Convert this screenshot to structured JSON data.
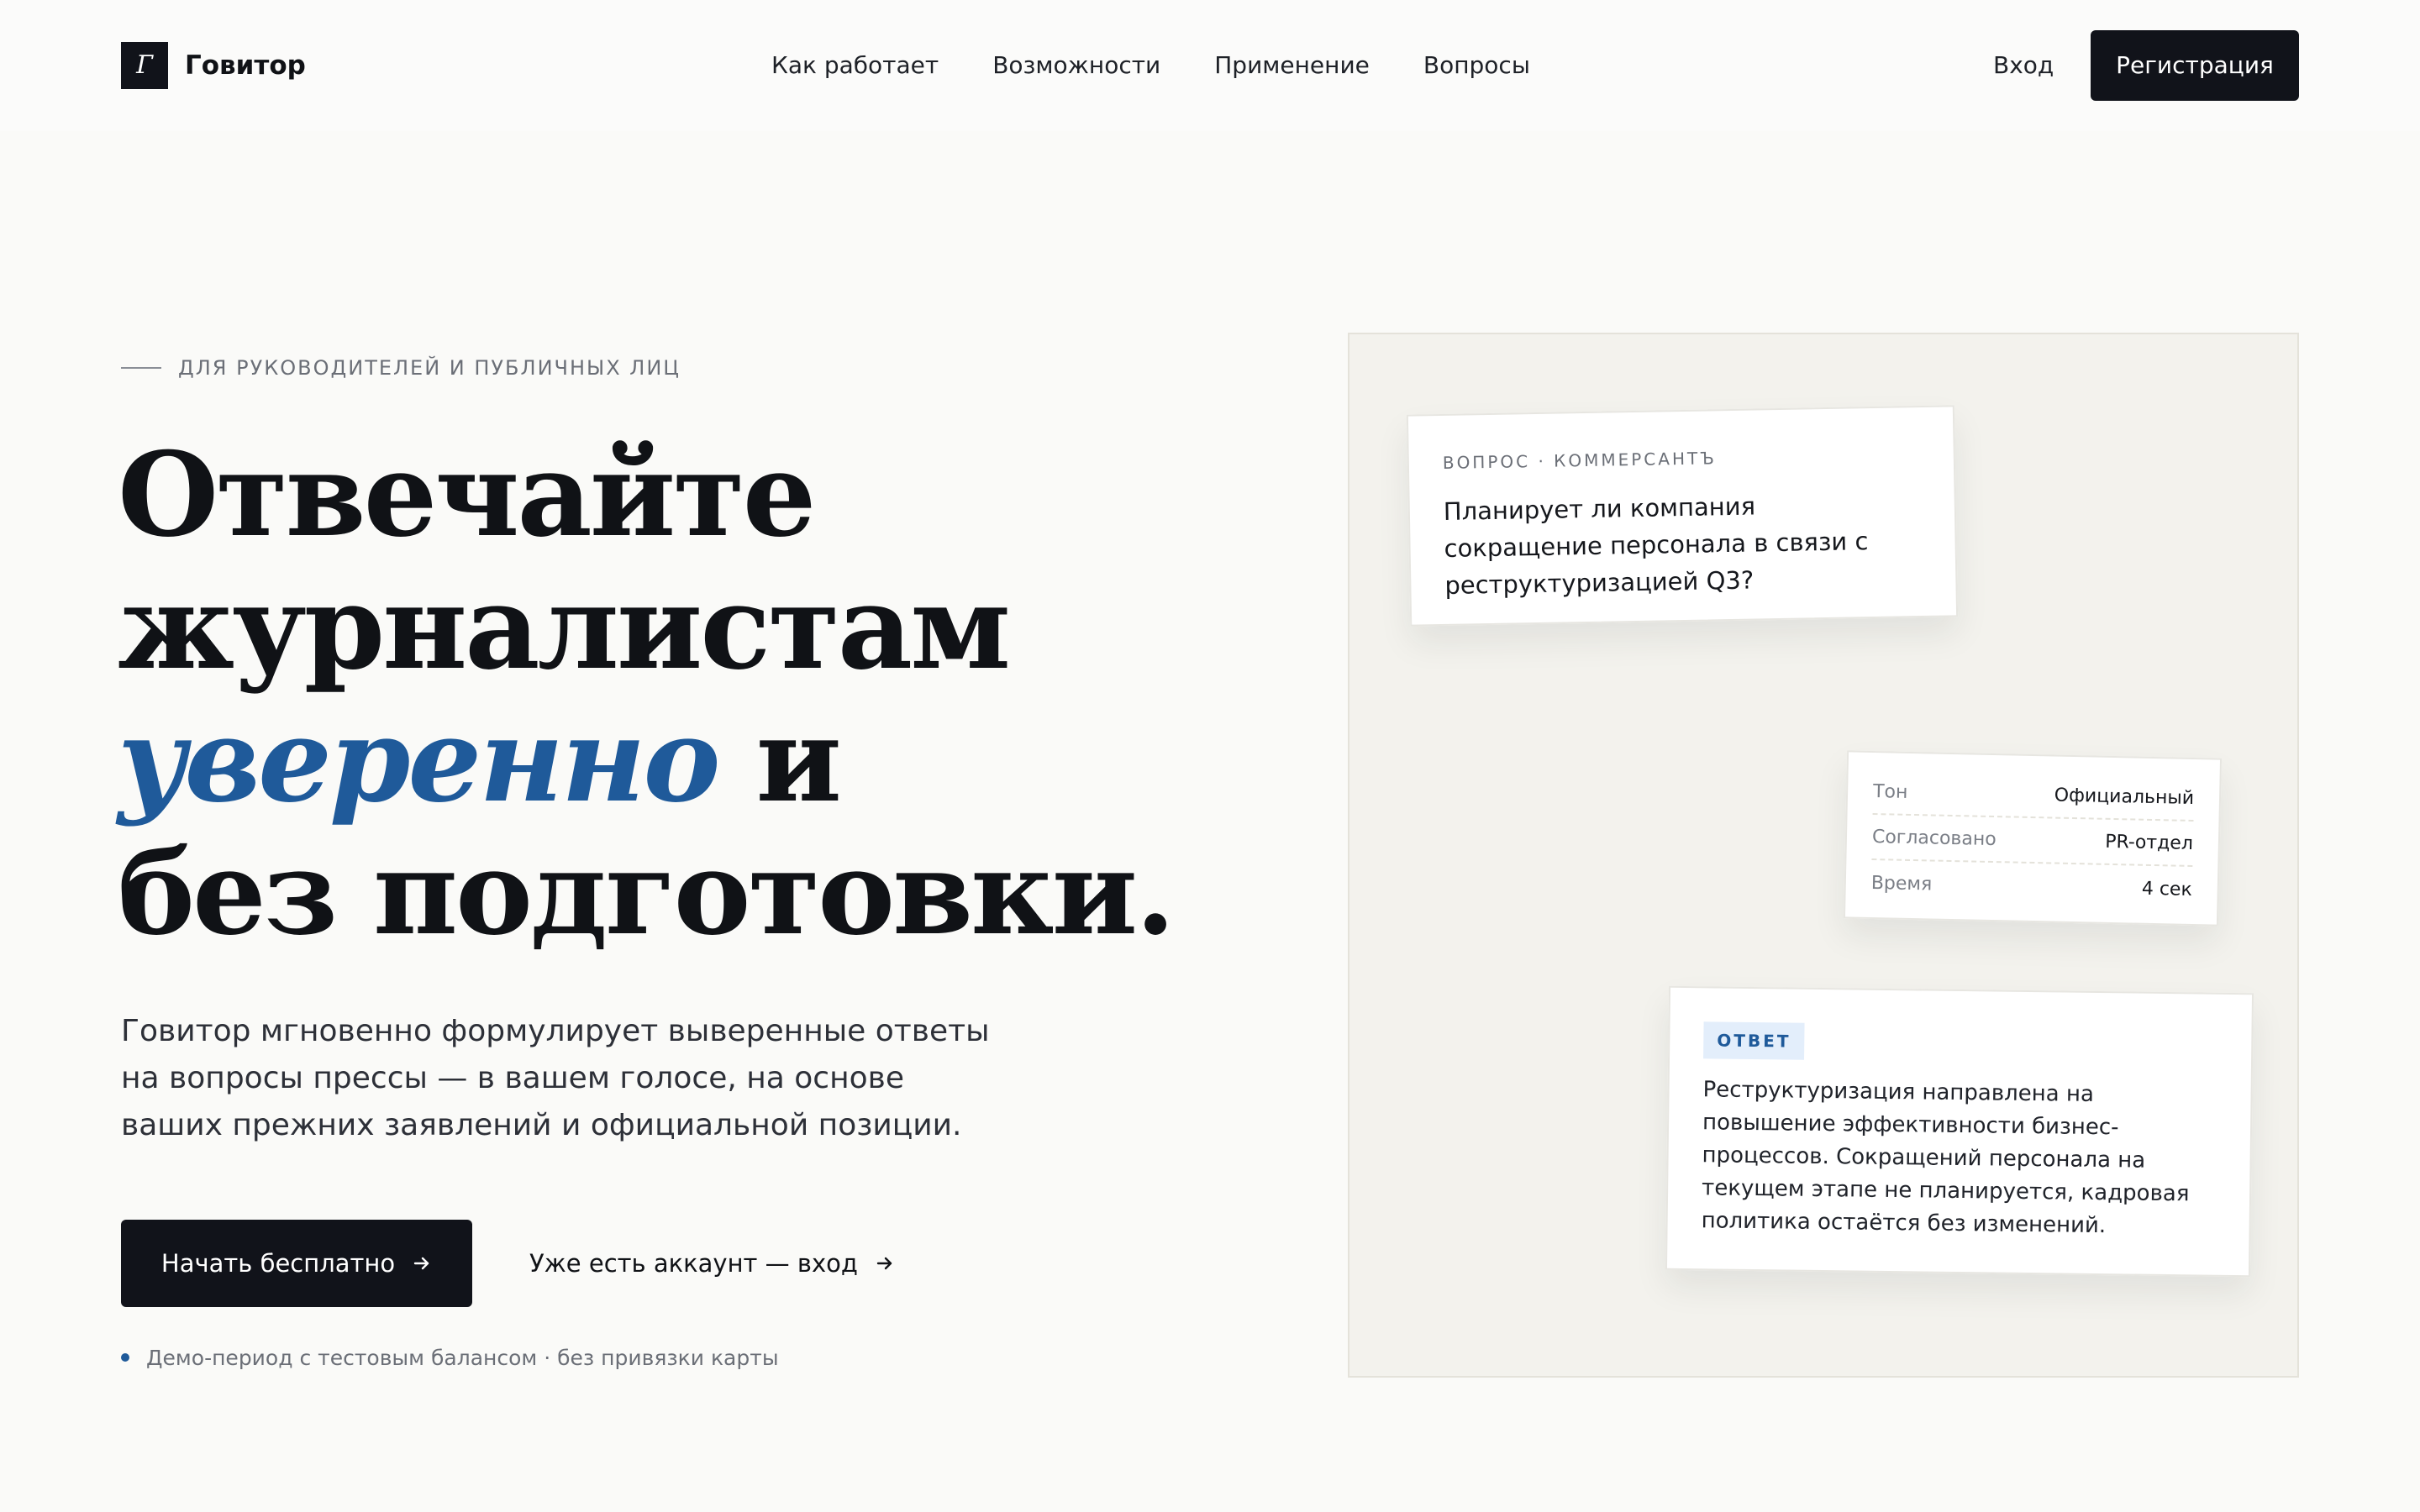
{
  "header": {
    "logo_mark": "Г",
    "logo_text": "Говитор",
    "nav": [
      "Как работает",
      "Возможности",
      "Применение",
      "Вопросы"
    ],
    "login": "Вход",
    "register": "Регистрация"
  },
  "hero": {
    "eyebrow": "ДЛЯ РУКОВОДИТЕЛЕЙ И ПУБЛИЧНЫХ ЛИЦ",
    "headline": {
      "line1": "Отвечайте",
      "line2": "журналистам",
      "accent": "уверенно",
      "line3_rest": " и",
      "line4": "без подготовки."
    },
    "lead": "Говитор мгновенно формулирует выверенные ответы на вопросы прессы — в вашем голосе, на основе ваших прежних заявлений и официальной позиции.",
    "cta_primary": "Начать бесплатно",
    "cta_secondary": "Уже есть аккаунт — вход",
    "note": "Демо-период с тестовым балансом · без привязки карты"
  },
  "illustration": {
    "question": {
      "label": "ВОПРОС · КОММЕРСАНТЪ",
      "text": "Планирует ли компания сокращение персонала в связи с реструктуризацией Q3?"
    },
    "meta": [
      {
        "key": "Тон",
        "value": "Официальный"
      },
      {
        "key": "Согласовано",
        "value": "PR-отдел"
      },
      {
        "key": "Время",
        "value": "4 сек"
      }
    ],
    "answer": {
      "badge": "ОТВЕТ",
      "text": "Реструктуризация направлена на повышение эффективности бизнес-процессов. Сокращений персонала на текущем этапе не планируется, кадровая политика остаётся без изменений."
    }
  },
  "colors": {
    "accent": "#1f5a9a",
    "dark": "#11131a",
    "background": "#fafaf8"
  }
}
